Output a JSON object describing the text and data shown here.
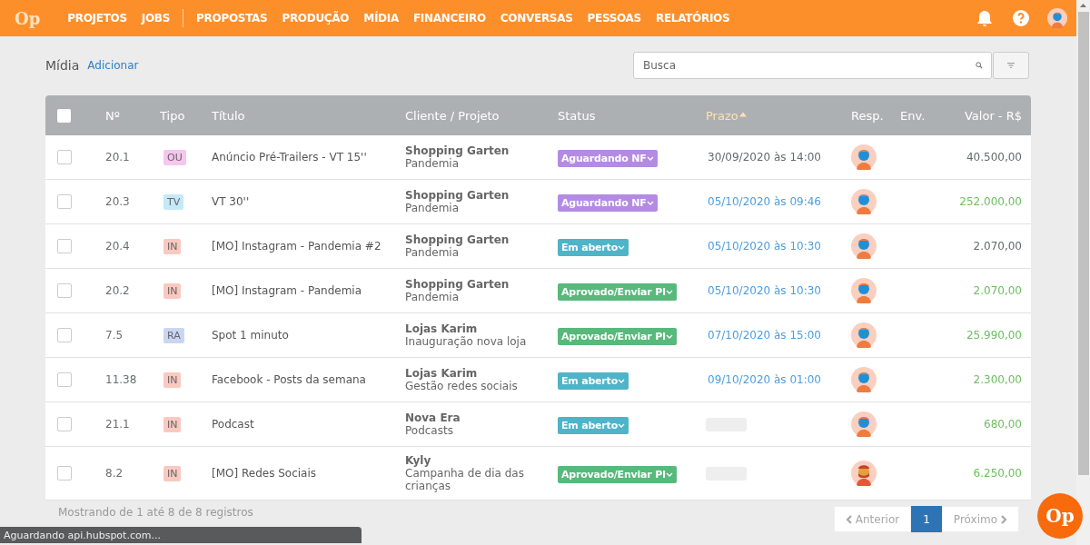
{
  "topbar": {
    "logo": "Op",
    "nav": [
      "PROJETOS",
      "JOBS",
      "PROPOSTAS",
      "PRODUÇÃO",
      "MÍDIA",
      "FINANCEIRO",
      "CONVERSAS",
      "PESSOAS",
      "RELATÓRIOS"
    ]
  },
  "page": {
    "title": "Mídia",
    "add_link": "Adicionar"
  },
  "search": {
    "placeholder": "Busca"
  },
  "table": {
    "select_all": {
      "checked": false
    },
    "columns": [
      {
        "label": "Nº",
        "sorted": false
      },
      {
        "label": "Tipo",
        "sorted": false
      },
      {
        "label": "Título",
        "sorted": false
      },
      {
        "label": "Cliente / Projeto",
        "sorted": false
      },
      {
        "label": "Status",
        "sorted": false
      },
      {
        "label": "Prazo",
        "sorted": true
      },
      {
        "label": "Resp.",
        "sorted": false
      },
      {
        "label": "Env.",
        "sorted": false
      },
      {
        "label": "Valor - R$",
        "sorted": false
      }
    ],
    "rows": [
      {
        "checked": false,
        "number": "20.1",
        "type": {
          "text": "OU",
          "color": "#f6c6ee"
        },
        "title": "Anúncio Pré-Trailers - VT 15''",
        "client": "Shopping Garten",
        "project": "Pandemia",
        "status": {
          "text": "Aguardando NF",
          "color": "#b48be3"
        },
        "deadline": {
          "kind": "date",
          "text": "30/09/2020 às 14:00",
          "color": "#666a6e"
        },
        "resp": {
          "kind": "masked"
        },
        "value": {
          "text": "40.500,00",
          "color": "#666a6e"
        }
      },
      {
        "checked": false,
        "number": "20.3",
        "type": {
          "text": "TV",
          "color": "#c4e9f7"
        },
        "title": "VT 30''",
        "client": "Shopping Garten",
        "project": "Pandemia",
        "status": {
          "text": "Aguardando NF",
          "color": "#b48be3"
        },
        "deadline": {
          "kind": "date",
          "text": "05/10/2020 às 09:46",
          "color": "#4c9ee0"
        },
        "resp": {
          "kind": "masked"
        },
        "value": {
          "text": "252.000,00",
          "color": "#6cbf5f"
        }
      },
      {
        "checked": false,
        "number": "20.4",
        "type": {
          "text": "IN",
          "color": "#f9c9c0"
        },
        "title": "[MO] Instagram - Pandemia #2",
        "client": "Shopping Garten",
        "project": "Pandemia",
        "status": {
          "text": "Em aberto",
          "color": "#4fb4c8"
        },
        "deadline": {
          "kind": "date",
          "text": "05/10/2020 às 10:30",
          "color": "#4c9ee0"
        },
        "resp": {
          "kind": "masked"
        },
        "value": {
          "text": "2.070,00",
          "color": "#666a6e"
        }
      },
      {
        "checked": false,
        "number": "20.2",
        "type": {
          "text": "IN",
          "color": "#f9c9c0"
        },
        "title": "[MO] Instagram - Pandemia",
        "client": "Shopping Garten",
        "project": "Pandemia",
        "status": {
          "text": "Aprovado/Enviar PI",
          "color": "#57b97b"
        },
        "deadline": {
          "kind": "date",
          "text": "05/10/2020 às 10:30",
          "color": "#4c9ee0"
        },
        "resp": {
          "kind": "masked"
        },
        "value": {
          "text": "2.070,00",
          "color": "#6cbf5f"
        }
      },
      {
        "checked": false,
        "number": "7.5",
        "type": {
          "text": "RA",
          "color": "#c9d6f2"
        },
        "title": "Spot 1 minuto",
        "client": "Lojas Karim",
        "project": "Inauguração nova loja",
        "status": {
          "text": "Aprovado/Enviar PI",
          "color": "#57b97b"
        },
        "deadline": {
          "kind": "date",
          "text": "07/10/2020 às 15:00",
          "color": "#4c9ee0"
        },
        "resp": {
          "kind": "masked"
        },
        "value": {
          "text": "25.990,00",
          "color": "#6cbf5f"
        }
      },
      {
        "checked": false,
        "number": "11.38",
        "type": {
          "text": "IN",
          "color": "#f9c9c0"
        },
        "title": "Facebook - Posts da semana",
        "client": "Lojas Karim",
        "project": "Gestão redes sociais",
        "status": {
          "text": "Em aberto",
          "color": "#4fb4c8"
        },
        "deadline": {
          "kind": "date",
          "text": "09/10/2020 às 01:00",
          "color": "#4c9ee0"
        },
        "resp": {
          "kind": "masked"
        },
        "value": {
          "text": "2.300,00",
          "color": "#6cbf5f"
        }
      },
      {
        "checked": false,
        "number": "21.1",
        "type": {
          "text": "IN",
          "color": "#f9c9c0"
        },
        "title": "Podcast",
        "client": "Nova Era",
        "project": "Podcasts",
        "status": {
          "text": "Em aberto",
          "color": "#4fb4c8"
        },
        "deadline": {
          "kind": "empty"
        },
        "resp": {
          "kind": "masked"
        },
        "value": {
          "text": "680,00",
          "color": "#6cbf5f"
        }
      },
      {
        "checked": false,
        "number": "8.2",
        "type": {
          "text": "IN",
          "color": "#f9c9c0"
        },
        "title": "[MO] Redes Sociais",
        "client": "Kyly",
        "project": "Campanha de dia das crianças",
        "status": {
          "text": "Aprovado/Enviar PI",
          "color": "#57b97b"
        },
        "deadline": {
          "kind": "empty"
        },
        "resp": {
          "kind": "bearded"
        },
        "value": {
          "text": "6.250,00",
          "color": "#6cbf5f"
        }
      }
    ]
  },
  "footer": {
    "info": "Mostrando de 1 até 8 de 8 registros",
    "pagination": [
      {
        "kind": "prev",
        "label": "Anterior",
        "disabled": true,
        "selected": false
      },
      {
        "kind": "page",
        "label": "1",
        "disabled": false,
        "selected": true
      },
      {
        "kind": "next",
        "label": "Próximo",
        "disabled": true,
        "selected": false
      }
    ]
  },
  "chat_button": {
    "label": "Op"
  },
  "browser_status": "Aguardando api.hubspot.com..."
}
